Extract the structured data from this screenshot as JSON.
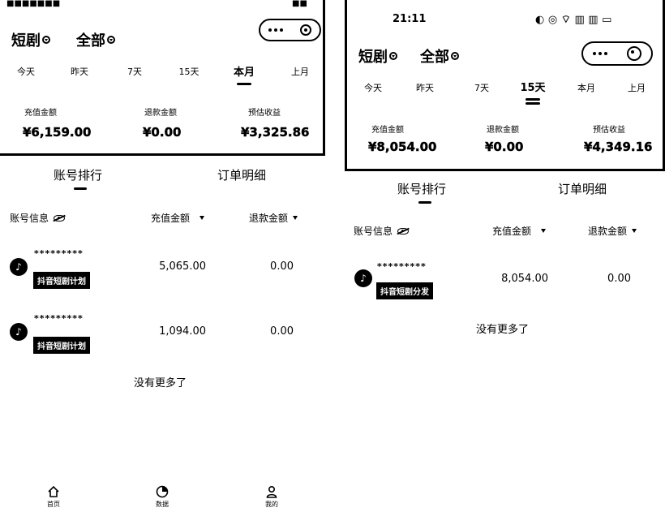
{
  "left": {
    "status": {
      "left_text": "■■■■■■■",
      "right_text": "■■"
    },
    "filters": {
      "category": "短剧",
      "scope": "全部"
    },
    "date_tabs": [
      "今天",
      "昨天",
      "7天",
      "15天",
      "本月",
      "上月"
    ],
    "active_tab_index": 4,
    "metrics": [
      {
        "label": "充值金额",
        "value": "¥6,159.00"
      },
      {
        "label": "退款金额",
        "value": "¥0.00"
      },
      {
        "label": "预估收益",
        "value": "¥3,325.86"
      }
    ],
    "section_tabs": [
      "账号排行",
      "订单明细"
    ],
    "table_headers": {
      "account": "账号信息",
      "recharge": "充值金额",
      "refund": "退款金额"
    },
    "rows": [
      {
        "id": "*********",
        "tag": "抖音短剧计划",
        "recharge": "5,065.00",
        "refund": "0.00"
      },
      {
        "id": "*********",
        "tag": "抖音短剧计划",
        "recharge": "1,094.00",
        "refund": "0.00"
      }
    ],
    "no_more": "没有更多了",
    "bottom_nav": [
      {
        "label": "首页",
        "icon": "home-icon"
      },
      {
        "label": "数据",
        "icon": "pie-chart-icon"
      },
      {
        "label": "我的",
        "icon": "user-icon"
      }
    ]
  },
  "right": {
    "status": {
      "time": "21:11",
      "right_text": "◐ ◎ ⌔ ▥ ▥ ▭"
    },
    "filters": {
      "category": "短剧",
      "scope": "全部"
    },
    "date_tabs": [
      "今天",
      "昨天",
      "7天",
      "15天",
      "本月",
      "上月"
    ],
    "active_tab_index": 3,
    "metrics": [
      {
        "label": "充值金额",
        "value": "¥8,054.00"
      },
      {
        "label": "退款金额",
        "value": "¥0.00"
      },
      {
        "label": "预估收益",
        "value": "¥4,349.16"
      }
    ],
    "section_tabs": [
      "账号排行",
      "订单明细"
    ],
    "table_headers": {
      "account": "账号信息",
      "recharge": "充值金额",
      "refund": "退款金额"
    },
    "rows": [
      {
        "id": "*********",
        "tag": "抖音短剧分发",
        "recharge": "8,054.00",
        "refund": "0.00"
      }
    ],
    "no_more": "没有更多了"
  }
}
